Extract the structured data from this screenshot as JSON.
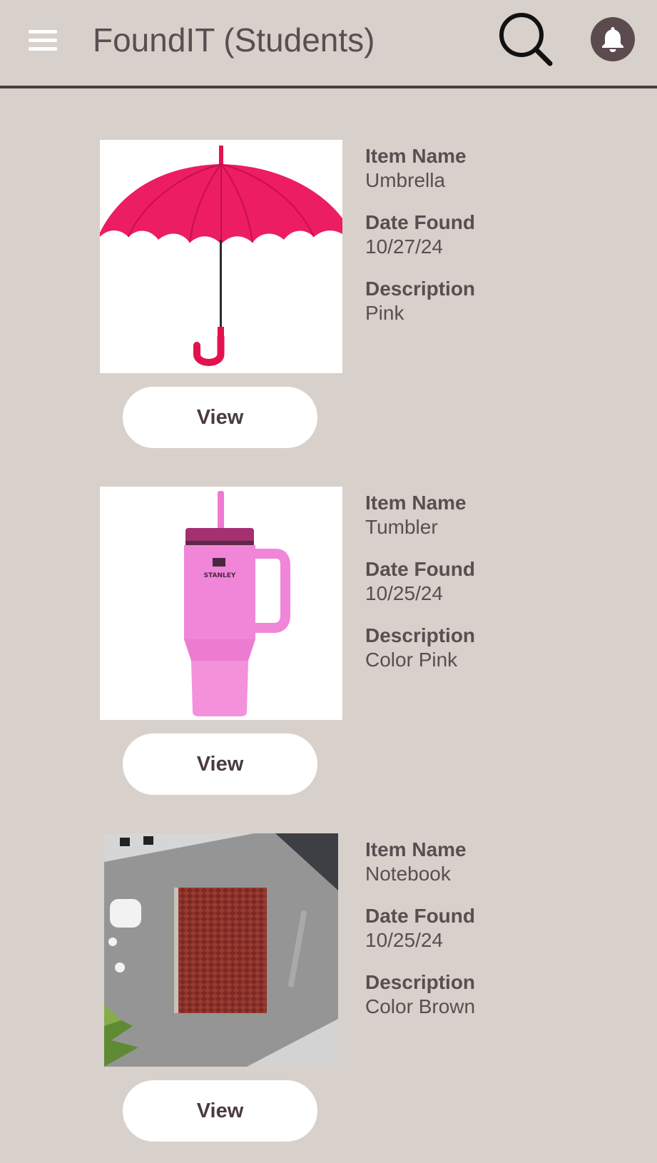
{
  "header": {
    "title": "FoundIT (Students)",
    "menu_icon": "hamburger-menu-icon",
    "search_icon": "search-icon",
    "bell_icon": "bell-icon"
  },
  "labels": {
    "item_name": "Item Name",
    "date_found": "Date Found",
    "description": "Description"
  },
  "items": [
    {
      "image": "umbrella-photo",
      "item_name": "Umbrella",
      "date_found": "10/27/24",
      "description": "Pink",
      "view_label": "View"
    },
    {
      "image": "tumbler-photo",
      "image_text": "STANLEY",
      "item_name": "Tumbler",
      "date_found": "10/25/24",
      "description": "Color Pink",
      "view_label": "View"
    },
    {
      "image": "notebook-photo",
      "item_name": "Notebook",
      "date_found": "10/25/24",
      "description": "Color Brown",
      "view_label": "View"
    }
  ],
  "colors": {
    "background": "#d8d0ca",
    "header_divider": "#4a3b3e",
    "text": "#5a4e51",
    "button_bg": "#ffffff",
    "bell_circle": "#5b4b4e"
  }
}
